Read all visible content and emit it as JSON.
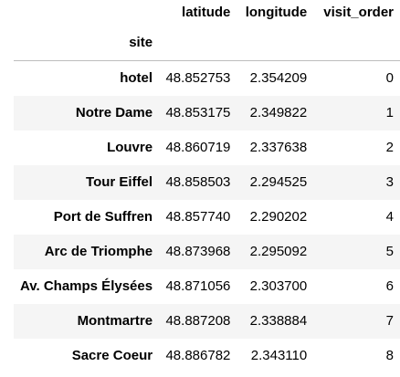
{
  "table": {
    "columns": [
      "latitude",
      "longitude",
      "visit_order"
    ],
    "index_name": "site",
    "rows": [
      {
        "site": "hotel",
        "latitude": "48.852753",
        "longitude": "2.354209",
        "visit_order": "0"
      },
      {
        "site": "Notre Dame",
        "latitude": "48.853175",
        "longitude": "2.349822",
        "visit_order": "1"
      },
      {
        "site": "Louvre",
        "latitude": "48.860719",
        "longitude": "2.337638",
        "visit_order": "2"
      },
      {
        "site": "Tour Eiffel",
        "latitude": "48.858503",
        "longitude": "2.294525",
        "visit_order": "3"
      },
      {
        "site": "Port de Suffren",
        "latitude": "48.857740",
        "longitude": "2.290202",
        "visit_order": "4"
      },
      {
        "site": "Arc de Triomphe",
        "latitude": "48.873968",
        "longitude": "2.295092",
        "visit_order": "5"
      },
      {
        "site": "Av. Champs Élysées",
        "latitude": "48.871056",
        "longitude": "2.303700",
        "visit_order": "6"
      },
      {
        "site": "Montmartre",
        "latitude": "48.887208",
        "longitude": "2.338884",
        "visit_order": "7"
      },
      {
        "site": "Sacre Coeur",
        "latitude": "48.886782",
        "longitude": "2.343110",
        "visit_order": "8"
      }
    ]
  }
}
